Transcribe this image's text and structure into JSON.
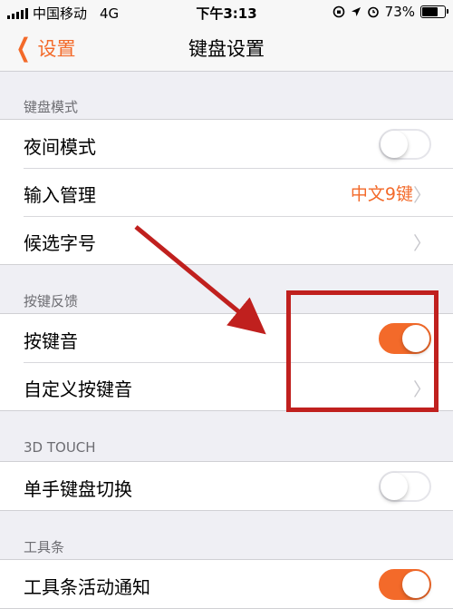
{
  "status_bar": {
    "carrier": "中国移动",
    "network": "4G",
    "time": "下午3:13",
    "battery": "73%",
    "battery_level": 0.73
  },
  "nav": {
    "back_label": "设置",
    "title": "键盘设置"
  },
  "sections": [
    {
      "header": "键盘模式",
      "rows": [
        {
          "label": "夜间模式",
          "toggle": false
        },
        {
          "label": "输入管理",
          "value": "中文9键",
          "arrow": true
        },
        {
          "label": "候选字号",
          "arrow": true
        }
      ]
    },
    {
      "header": "按键反馈",
      "rows": [
        {
          "label": "按键音",
          "toggle": true
        },
        {
          "label": "自定义按键音",
          "arrow": true
        }
      ]
    },
    {
      "header": "3D TOUCH",
      "rows": [
        {
          "label": "单手键盘切换",
          "toggle": false
        }
      ]
    },
    {
      "header": "工具条",
      "rows": [
        {
          "label": "工具条活动通知",
          "toggle": true
        }
      ]
    }
  ],
  "icons": {
    "back": "chevron-left-icon",
    "arrow": "chevron-right-icon",
    "location": "location-icon",
    "alarm": "alarm-icon",
    "lock": "orientation-lock-icon"
  },
  "colors": {
    "accent": "#f36a2a",
    "annotation": "#c0201e"
  }
}
